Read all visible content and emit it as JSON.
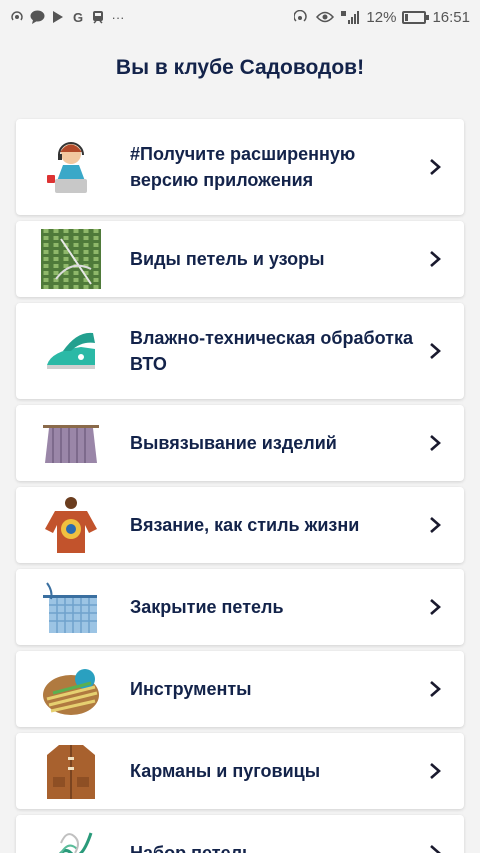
{
  "status_bar": {
    "battery_percent": "12%",
    "time": "16:51",
    "left_icons": [
      "hotspot-icon",
      "message-icon",
      "play-icon",
      "google-icon",
      "train-icon",
      "more-icon"
    ],
    "right_icons": [
      "nfc-icon",
      "eye-icon",
      "signal-icon"
    ]
  },
  "header": {
    "title": "Вы в клубе Садоводов!"
  },
  "colors": {
    "title": "#13234a",
    "background": "#f3f3f3",
    "card": "#ffffff"
  },
  "menu": {
    "items": [
      {
        "label": "#Получите расширенную версию приложения",
        "icon": "support-operator-icon"
      },
      {
        "label": "Виды петель и узоры",
        "icon": "knit-pattern-icon"
      },
      {
        "label": "Влажно-техническая обработка ВТО",
        "icon": "steam-iron-icon"
      },
      {
        "label": "Вывязывание изделий",
        "icon": "knitting-on-needle-icon"
      },
      {
        "label": "Вязание, как стиль жизни",
        "icon": "knitted-sweater-icon"
      },
      {
        "label": "Закрытие петель",
        "icon": "binding-off-icon"
      },
      {
        "label": "Инструменты",
        "icon": "knitting-tools-icon"
      },
      {
        "label": "Карманы и пуговицы",
        "icon": "coat-with-pockets-icon"
      },
      {
        "label": "Набор петель",
        "icon": "cast-on-icon"
      }
    ]
  }
}
